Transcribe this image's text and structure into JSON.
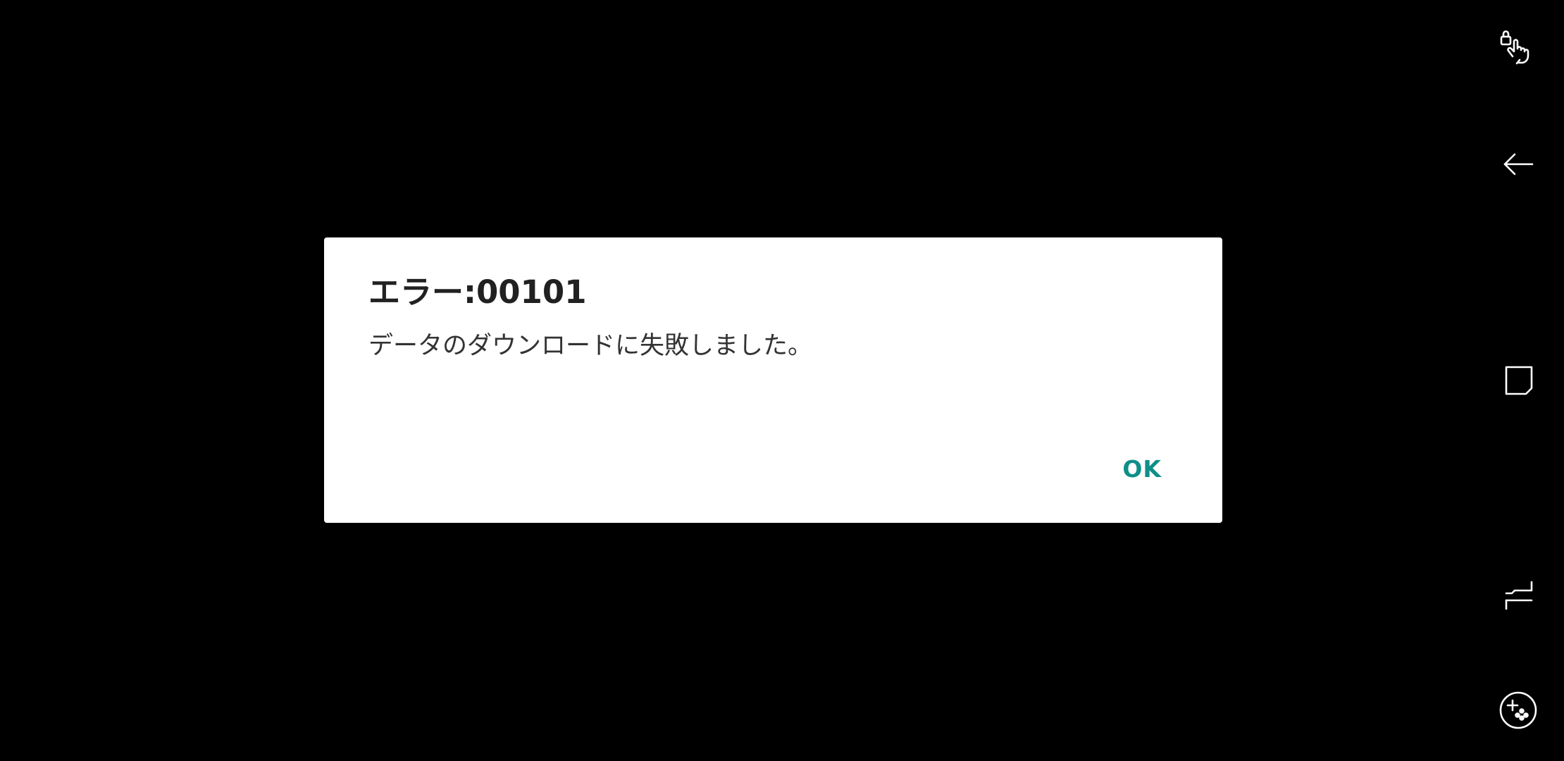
{
  "dialog": {
    "title": "エラー:00101",
    "message": "データのダウンロードに失敗しました。",
    "ok_label": "OK"
  },
  "colors": {
    "background": "#000000",
    "dialog_background": "#ffffff",
    "accent": "#0e8f88",
    "title_text": "#212121",
    "message_text": "#333333",
    "nav_icon": "#ffffff"
  },
  "nav_bar": {
    "buttons": [
      {
        "icon": "touch-lock-icon"
      },
      {
        "icon": "back-arrow-icon"
      },
      {
        "icon": "home-square-icon"
      },
      {
        "icon": "recents-icon"
      },
      {
        "icon": "game-tools-icon"
      }
    ]
  }
}
